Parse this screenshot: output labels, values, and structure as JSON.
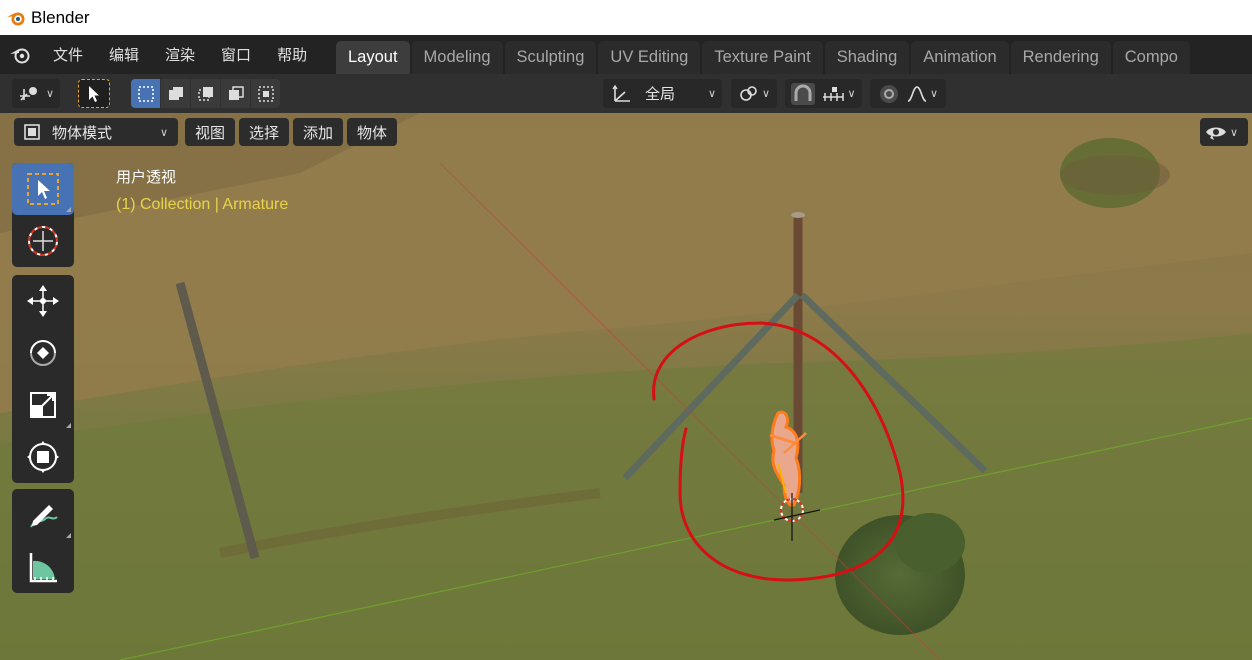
{
  "window": {
    "title": "Blender"
  },
  "menu": [
    "文件",
    "编辑",
    "渲染",
    "窗口",
    "帮助"
  ],
  "workspaces": [
    {
      "label": "Layout",
      "active": true
    },
    {
      "label": "Modeling"
    },
    {
      "label": "Sculpting"
    },
    {
      "label": "UV Editing"
    },
    {
      "label": "Texture Paint"
    },
    {
      "label": "Shading"
    },
    {
      "label": "Animation"
    },
    {
      "label": "Rendering"
    },
    {
      "label": "Compo"
    }
  ],
  "header": {
    "transform_orientation": "全局"
  },
  "viewport_header": {
    "mode": "物体模式",
    "menus": [
      "视图",
      "选择",
      "添加",
      "物体"
    ]
  },
  "viewport": {
    "perspective_label": "用户透视",
    "collection_label": "(1) Collection | Armature"
  },
  "colors": {
    "accent": "#4772b3",
    "active_object": "#ff8c3a",
    "annotation": "#d60f14",
    "collection_text": "#e8d44a"
  },
  "icons": [
    "blender-logo-icon",
    "select-box-icon",
    "cursor-icon",
    "move-icon",
    "rotate-icon",
    "scale-icon",
    "transform-icon",
    "annotate-icon",
    "measure-icon",
    "visibility-icon",
    "snap-icon",
    "proportional-edit-icon"
  ]
}
